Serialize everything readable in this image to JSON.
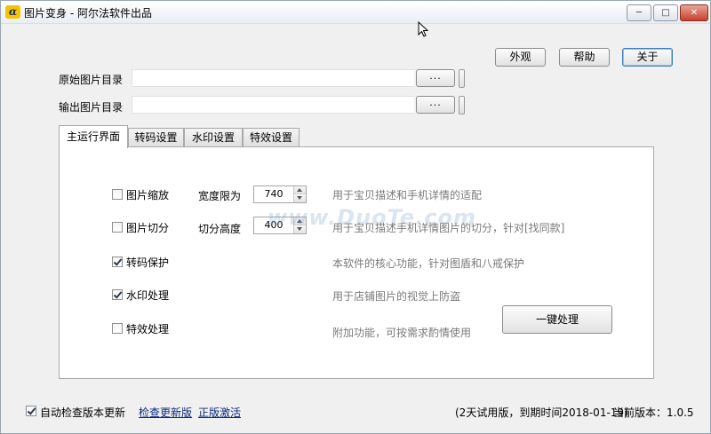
{
  "window": {
    "title": "图片变身 - 阿尔法软件出品",
    "app_icon_glyph": "α",
    "min_glyph": "▭",
    "max_glyph": "□",
    "close_glyph": "✕"
  },
  "top_buttons": {
    "appearance": "外观",
    "help": "帮助",
    "about": "关于"
  },
  "paths": {
    "source_label": "原始图片目录",
    "source_value": "",
    "output_label": "输出图片目录",
    "output_value": "",
    "browse_label": "...",
    "browse_label_2": "..."
  },
  "tabs": [
    {
      "label": "主运行界面",
      "active": true
    },
    {
      "label": "转码设置",
      "active": false
    },
    {
      "label": "水印设置",
      "active": false
    },
    {
      "label": "特效设置",
      "active": false
    }
  ],
  "options": {
    "resize": {
      "label": "图片缩放",
      "checked": false
    },
    "width_limit_label": "宽度限为",
    "width_limit_value": "740",
    "resize_desc": "用于宝贝描述和手机详情的适配",
    "split": {
      "label": "图片切分",
      "checked": false
    },
    "split_height_label": "切分高度",
    "split_height_value": "400",
    "split_desc": "用于宝贝描述手机详情图片的切分，针对[找同款]",
    "transcode": {
      "label": "转码保护",
      "checked": true
    },
    "transcode_desc": "本软件的核心功能，针对图盾和八戒保护",
    "watermark": {
      "label": "水印处理",
      "checked": true
    },
    "watermark_desc": "用于店铺图片的视觉上防盗",
    "effects": {
      "label": "特效处理",
      "checked": false
    },
    "effects_desc": "附加功能，可按需求酌情使用"
  },
  "run_button": "一键处理",
  "watermark_overlay": "www.DuoTe.com",
  "footer": {
    "auto_update": {
      "label": "自动检查版本更新",
      "checked": true
    },
    "check_update_link": "检查更新版",
    "activate_link": "正版激活",
    "trial_status": "(2天试用版，到期时间2018-01-19)",
    "version": "当前版本：1.0.5"
  }
}
